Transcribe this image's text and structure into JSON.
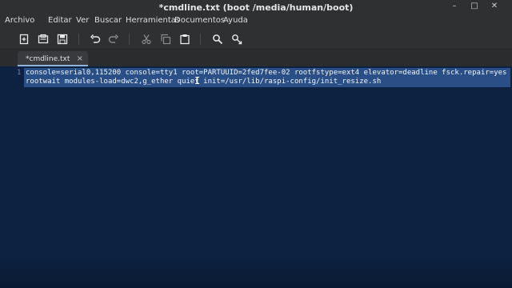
{
  "window": {
    "title": "*cmdline.txt (boot /media/human/boot)"
  },
  "menu": [
    "Archivo",
    "Editar",
    "Ver",
    "Buscar",
    "Herramientas",
    "Documentos",
    "Ayuda"
  ],
  "toolbar": {
    "icons": [
      "new-document-icon",
      "open-icon",
      "save-icon",
      "undo-icon",
      "redo-icon",
      "cut-icon",
      "copy-icon",
      "paste-icon",
      "search-icon",
      "replace-icon"
    ]
  },
  "tab": {
    "label": "*cmdline.txt",
    "close": "×"
  },
  "editor": {
    "line_number": "1",
    "line1": "console=serial0,115200 console=tty1 root=PARTUUID=2fed7fee-02 rootfstype=ext4 elevator=deadline fsck.repair=yes",
    "line2": "rootwait modules-load=dwc2,g_ether quiet init=/usr/lib/raspi-config/init_resize.sh"
  }
}
